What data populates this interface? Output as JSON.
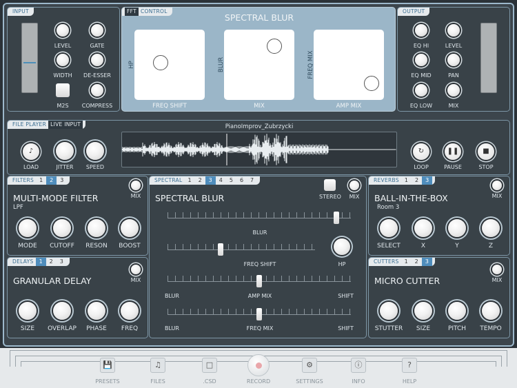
{
  "input": {
    "tab": "INPUT",
    "knobs": [
      "LEVEL",
      "GATE",
      "WIDTH",
      "DE-ESSER",
      "COMPRESS"
    ],
    "m2s": "M2S"
  },
  "fft": {
    "tabs": [
      "FFT",
      "CONTROL"
    ],
    "title": "SPECTRAL BLUR",
    "pads": [
      {
        "side": "HP",
        "bottom": "FREQ SHIFT",
        "dot": [
          0.37,
          0.47
        ]
      },
      {
        "side": "BLUR",
        "bottom": "MIX",
        "dot": [
          0.72,
          0.24
        ]
      },
      {
        "side": "FREQ MIX",
        "bottom": "AMP MIX",
        "dot": [
          0.82,
          0.76
        ]
      }
    ]
  },
  "output": {
    "tab": "OUTPUT",
    "knobs": [
      "EQ HI",
      "LEVEL",
      "EQ MID",
      "PAN",
      "EQ LOW",
      "MIX"
    ]
  },
  "player": {
    "tabs": [
      "FILE PLAYER",
      "LIVE INPUT"
    ],
    "filename": "PianoImprov_Zubrzycki",
    "load": "LOAD",
    "jitter": "JITTER",
    "speed": "SPEED",
    "loop": "LOOP",
    "pause": "PAUSE",
    "stop": "STOP"
  },
  "filters": {
    "tab": "FILTERS",
    "nums": [
      "1",
      "2",
      "3"
    ],
    "title": "MULTI-MODE FILTER",
    "sub": "LPF",
    "mix": "MIX",
    "knobs": [
      "MODE",
      "CUTOFF",
      "RESON",
      "BOOST"
    ]
  },
  "delays": {
    "tab": "DELAYS",
    "nums": [
      "1",
      "2",
      "3"
    ],
    "title": "GRANULAR DELAY",
    "mix": "MIX",
    "knobs": [
      "SIZE",
      "OVERLAP",
      "PHASE",
      "FREQ"
    ]
  },
  "spectral": {
    "tab": "SPECTRAL",
    "nums": [
      "1",
      "2",
      "3",
      "4",
      "5",
      "6",
      "7"
    ],
    "title": "SPECTRAL BLUR",
    "stereo": "STEREO",
    "mix": "MIX",
    "blur": "BLUR",
    "freqshift": "FREQ SHIFT",
    "hp": "HP",
    "ampmix": "AMP MIX",
    "freqmix": "FREQ MIX",
    "left": "BLUR",
    "right": "SHIFT",
    "left2": "BLUR",
    "right2": "SHIFT",
    "sliders": [
      0.92,
      0.36,
      0.5,
      0.5
    ]
  },
  "reverbs": {
    "tab": "REVERBS",
    "nums": [
      "1",
      "2",
      "3"
    ],
    "title": "BALL-IN-THE-BOX",
    "sub": "Room 3",
    "mix": "MIX",
    "knobs": [
      "SELECT",
      "X",
      "Y",
      "Z"
    ]
  },
  "cutters": {
    "tab": "CUTTERS",
    "nums": [
      "1",
      "2",
      "3"
    ],
    "title": "MICRO CUTTER",
    "mix": "MIX",
    "knobs": [
      "STUTTER",
      "SIZE",
      "PITCH",
      "TEMPO"
    ]
  },
  "toolbar": [
    "PRESETS",
    "FILES",
    ".CSD",
    "RECORD",
    "SETTINGS",
    "INFO",
    "HELP"
  ]
}
